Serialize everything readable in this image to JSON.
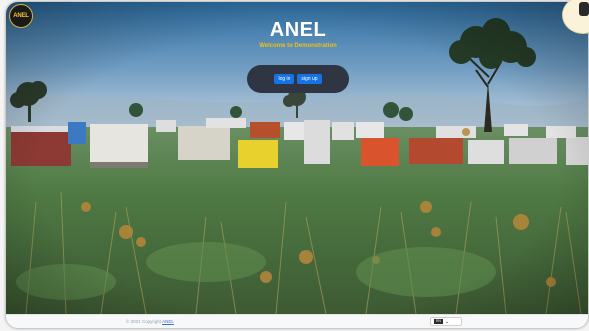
{
  "header": {
    "logo_text": "ANEL",
    "title": "ANEL",
    "subtitle": "Welcome to Demonstration"
  },
  "auth": {
    "login_label": "log in",
    "signup_label": "sign up"
  },
  "footer": {
    "copyright_prefix": "© 2021 Copyright",
    "copyright_link": "ANEL",
    "language_flag": "EN",
    "language_caret": "⌄"
  },
  "colors": {
    "accent": "#1673e6",
    "subtitle": "#f1c10f",
    "panel": "#2f3542"
  }
}
